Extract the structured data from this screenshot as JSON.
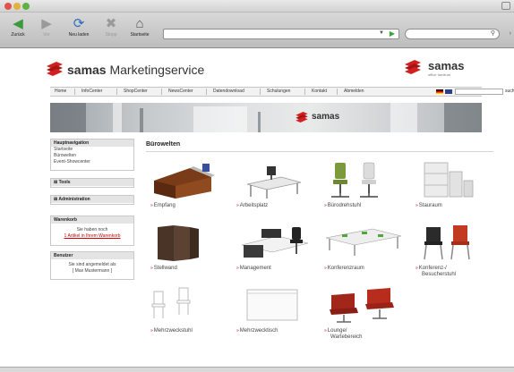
{
  "browser": {
    "toolbar": {
      "back_label": "Zurück",
      "forward_label": "Vor",
      "reload_label": "Neu laden",
      "stop_label": "Stopp",
      "home_label": "Startseite"
    },
    "url_value": "",
    "search_value": ""
  },
  "site": {
    "brand_bold": "samas",
    "brand_rest": " Marketingservice",
    "right_logo_text": "samas",
    "right_logo_sub": "office furniture",
    "banner_logo_text": "samas"
  },
  "nav": {
    "items": [
      "Home",
      "InfoCenter",
      "ShopCenter",
      "NewsCenter",
      "Datendownload",
      "Schulungen",
      "Kontakt",
      "Abmelden"
    ],
    "search_button": "suchen"
  },
  "sidebar": {
    "main_nav": {
      "title": "Hauptnavigation",
      "links": [
        "Startseite",
        "Bürowelten",
        "Event-Showcenter"
      ]
    },
    "tools_title": "Tools",
    "admin_title": "Administration",
    "cart": {
      "title": "Warenkorb",
      "line1": "Sie haben noch",
      "line2": "1 Artikel in Ihrem Warenkorb"
    },
    "user": {
      "title": "Benutzer",
      "line1": "Sie sind angemeldet als",
      "line2": "[ Max Mustermann ]"
    }
  },
  "content": {
    "title": "Bürowelten",
    "tiles": [
      {
        "label": "Empfang"
      },
      {
        "label": "Arbeitsplatz"
      },
      {
        "label": "Bürodrehstuhl"
      },
      {
        "label": "Stauraum"
      },
      {
        "label": "Stellwand"
      },
      {
        "label": "Management"
      },
      {
        "label": "Konferenzraum"
      },
      {
        "label": "Konferenz-/",
        "label2": "Besucherstuhl"
      },
      {
        "label": "Mehrzweckstuhl"
      },
      {
        "label": "Mehrzwecktisch"
      },
      {
        "label": "Lounge/",
        "label2": "Wartebereich"
      }
    ]
  },
  "colors": {
    "brand_red": "#d21f1f",
    "link_red": "#cc0000"
  }
}
